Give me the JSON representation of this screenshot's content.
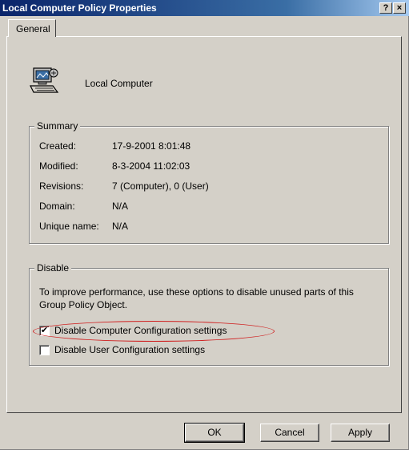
{
  "window": {
    "title": "Local Computer Policy Properties",
    "help_glyph": "?",
    "close_glyph": "×"
  },
  "tabs": [
    {
      "label": "General",
      "selected": true
    }
  ],
  "header": {
    "icon": "computer-icon",
    "label": "Local Computer"
  },
  "summary": {
    "legend": "Summary",
    "rows": [
      {
        "label": "Created:",
        "value": "17-9-2001 8:01:48"
      },
      {
        "label": "Modified:",
        "value": "8-3-2004 11:02:03"
      },
      {
        "label": "Revisions:",
        "value": "7 (Computer), 0 (User)"
      },
      {
        "label": "Domain:",
        "value": "N/A"
      },
      {
        "label": "Unique name:",
        "value": "N/A"
      }
    ]
  },
  "disable": {
    "legend": "Disable",
    "description": "To improve performance, use these options to disable unused parts of this Group Policy Object.",
    "options": [
      {
        "label": "Disable Computer Configuration settings",
        "checked": true
      },
      {
        "label": "Disable User Configuration settings",
        "checked": false
      }
    ]
  },
  "buttons": {
    "ok": "OK",
    "cancel": "Cancel",
    "apply": "Apply"
  },
  "colors": {
    "title_bar": "#0a246a",
    "dialog_face": "#d4d0c8",
    "highlight_ellipse": "#d02020"
  }
}
